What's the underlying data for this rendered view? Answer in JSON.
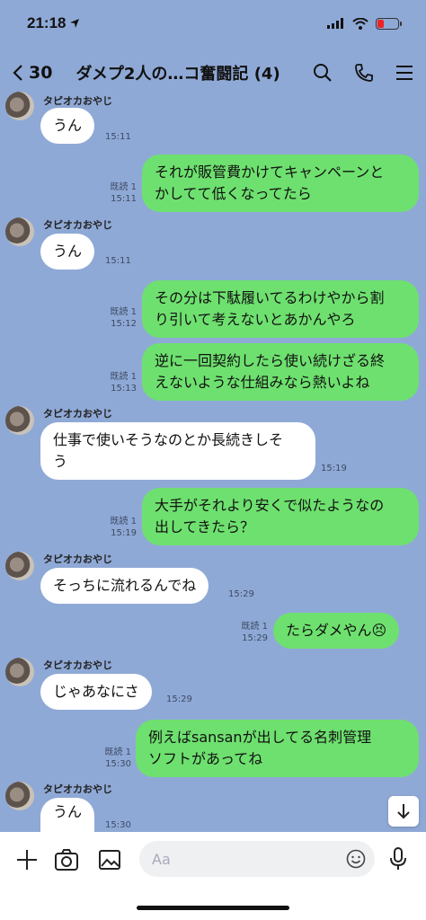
{
  "status_bar": {
    "time": "21:18",
    "battery_level": 0.3
  },
  "header": {
    "back_count": "30",
    "title": "ダメプ2人の…コ奮闘記 (4)",
    "icons": [
      "search-icon",
      "phone-icon",
      "menu-icon"
    ]
  },
  "messages": [
    {
      "from": "in",
      "sender": "タピオカおやじ",
      "text": "うん",
      "time": "15:11"
    },
    {
      "from": "out",
      "read": "既読 1",
      "time": "15:11",
      "lines": [
        "それが販管費かけてキャンペーンと",
        "かしてて低くなってたら"
      ]
    },
    {
      "from": "in",
      "sender": "タピオカおやじ",
      "text": "うん",
      "time": "15:11"
    },
    {
      "from": "out",
      "read": "既読 1",
      "time": "15:12",
      "lines": [
        "その分は下駄履いてるわけやから割",
        "り引いて考えないとあかんやろ"
      ]
    },
    {
      "from": "out",
      "read": "既読 1",
      "time": "15:13",
      "lines": [
        "逆に一回契約したら使い続けざる終",
        "えないような仕組みなら熱いよね"
      ]
    },
    {
      "from": "in",
      "sender": "タピオカおやじ",
      "lines": [
        "仕事で使いそうなのとか長続きしそ",
        "う"
      ],
      "time": "15:19"
    },
    {
      "from": "out",
      "read": "既読 1",
      "time": "15:19",
      "lines": [
        "大手がそれより安くで似たようなの",
        "出してきたら？"
      ]
    },
    {
      "from": "in",
      "sender": "タピオカおやじ",
      "text": "そっちに流れるんでね",
      "time": "15:29"
    },
    {
      "from": "out",
      "read": "既読 1",
      "time": "15:29",
      "text": "たらダメやん😣"
    },
    {
      "from": "in",
      "sender": "タピオカおやじ",
      "text": "じゃあなにさ",
      "time": "15:29"
    },
    {
      "from": "out",
      "read": "既読 1",
      "time": "15:30",
      "lines": [
        "例えばsansanが出してる名刺管理",
        "ソフトがあってね"
      ]
    },
    {
      "from": "in",
      "sender": "タピオカおやじ",
      "text": "うん",
      "time": "15:30"
    }
  ],
  "input": {
    "placeholder": "Aa"
  },
  "colors": {
    "background": "#8fa9d6",
    "outgoing": "#6ee06f",
    "incoming": "#ffffff"
  }
}
